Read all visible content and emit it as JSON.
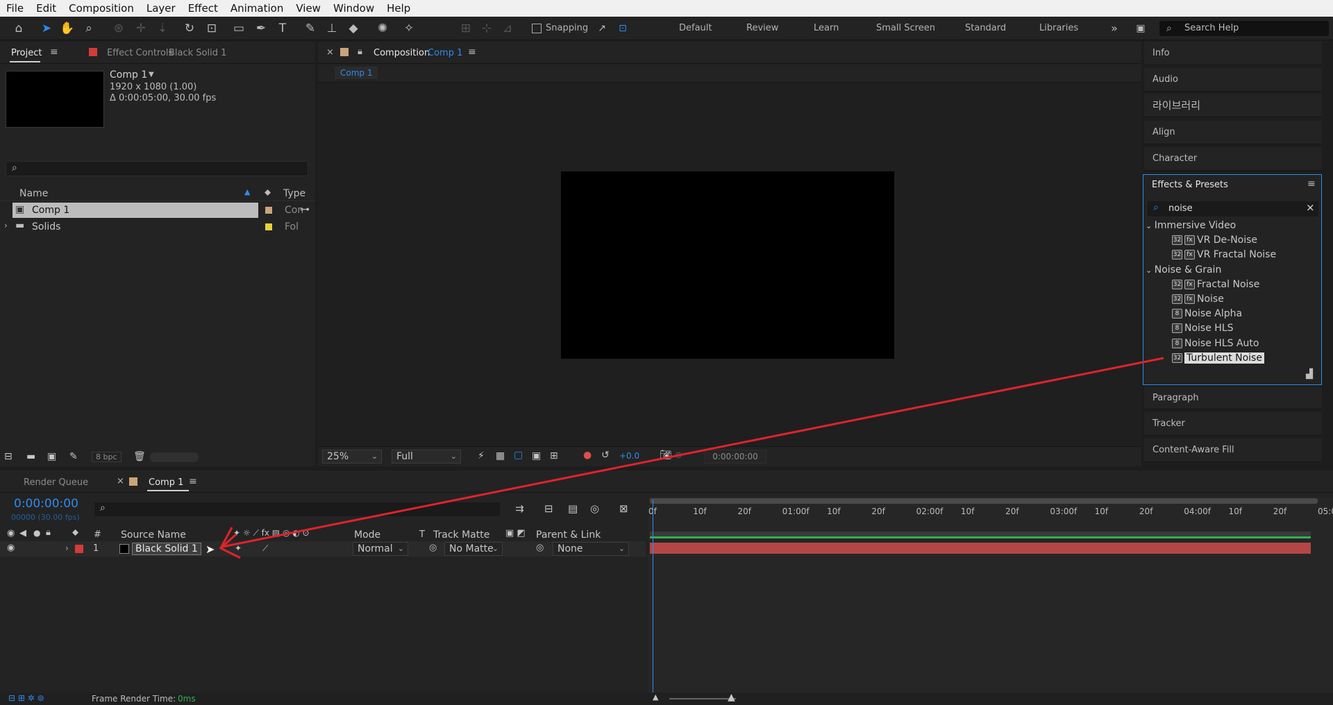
{
  "menu": [
    "File",
    "Edit",
    "Composition",
    "Layer",
    "Effect",
    "Animation",
    "View",
    "Window",
    "Help"
  ],
  "toolbar": {
    "snapping": "Snapping",
    "workspaces": [
      "Default",
      "Review",
      "Learn",
      "Small Screen",
      "Standard",
      "Libraries"
    ],
    "search_help": "Search Help"
  },
  "project": {
    "tab": "Project",
    "effect_controls_tab": "Effect Controls",
    "effect_controls_target": "Black Solid 1",
    "comp_name": "Comp 1",
    "comp_size": "1920 x 1080 (1.00)",
    "comp_duration": "Δ 0:00:05:00, 30.00 fps",
    "col_name": "Name",
    "col_type": "Type",
    "items": [
      {
        "name": "Comp 1",
        "type": "Con",
        "color": "#c9a57a"
      },
      {
        "name": "Solids",
        "type": "Fol",
        "color": "#e8d13c"
      }
    ],
    "bpc": "8 bpc"
  },
  "composition": {
    "tab_prefix": "Composition",
    "tab_name": "Comp 1",
    "sub_tab": "Comp 1",
    "zoom": "25%",
    "resolution": "Full",
    "exposure": "+0.0",
    "timecode": "0:00:00:00"
  },
  "right_panels": {
    "top": [
      "Info",
      "Audio",
      "라이브러리",
      "Align",
      "Character"
    ],
    "effects_title": "Effects & Presets",
    "search_value": "noise",
    "bottom": [
      "Paragraph",
      "Tracker",
      "Content-Aware Fill"
    ]
  },
  "effects_tree": [
    {
      "label": "Immersive Video",
      "kind": "group"
    },
    {
      "label": "VR De-Noise",
      "kind": "item",
      "badges": [
        "32",
        "fx"
      ]
    },
    {
      "label": "VR Fractal Noise",
      "kind": "item",
      "badges": [
        "32",
        "fx"
      ]
    },
    {
      "label": "Noise & Grain",
      "kind": "group"
    },
    {
      "label": "Fractal Noise",
      "kind": "item",
      "badges": [
        "32",
        "fx"
      ]
    },
    {
      "label": "Noise",
      "kind": "item",
      "badges": [
        "32",
        "fx"
      ]
    },
    {
      "label": "Noise Alpha",
      "kind": "item",
      "badges": [
        "8"
      ]
    },
    {
      "label": "Noise HLS",
      "kind": "item",
      "badges": [
        "8"
      ]
    },
    {
      "label": "Noise HLS Auto",
      "kind": "item",
      "badges": [
        "8"
      ]
    },
    {
      "label": "Turbulent Noise",
      "kind": "item",
      "badges": [
        "32"
      ],
      "selected": true
    }
  ],
  "timeline": {
    "render_queue_tab": "Render Queue",
    "comp_tab": "Comp 1",
    "timecode": "0:00:00:00",
    "frame_info": "00000 (30.00 fps)",
    "col_source": "Source Name",
    "col_hash": "#",
    "col_mode": "Mode",
    "col_t": "T",
    "col_track": "Track Matte",
    "col_parent": "Parent & Link",
    "layer": {
      "index": "1",
      "name": "Black Solid 1",
      "mode": "Normal",
      "matte": "No Matte",
      "parent": "None",
      "label_color": "#d23b3b"
    },
    "ruler": [
      "0f",
      "10f",
      "20f",
      "01:00f",
      "10f",
      "20f",
      "02:00f",
      "10f",
      "20f",
      "03:00f",
      "10f",
      "20f",
      "04:00f",
      "10f",
      "20f",
      "05:0"
    ],
    "frame_render_label": "Frame Render Time:",
    "frame_render_value": "0ms"
  },
  "colors": {
    "accent": "#2d8ceb",
    "bar": "#b44646",
    "arrow": "#e0232b"
  }
}
